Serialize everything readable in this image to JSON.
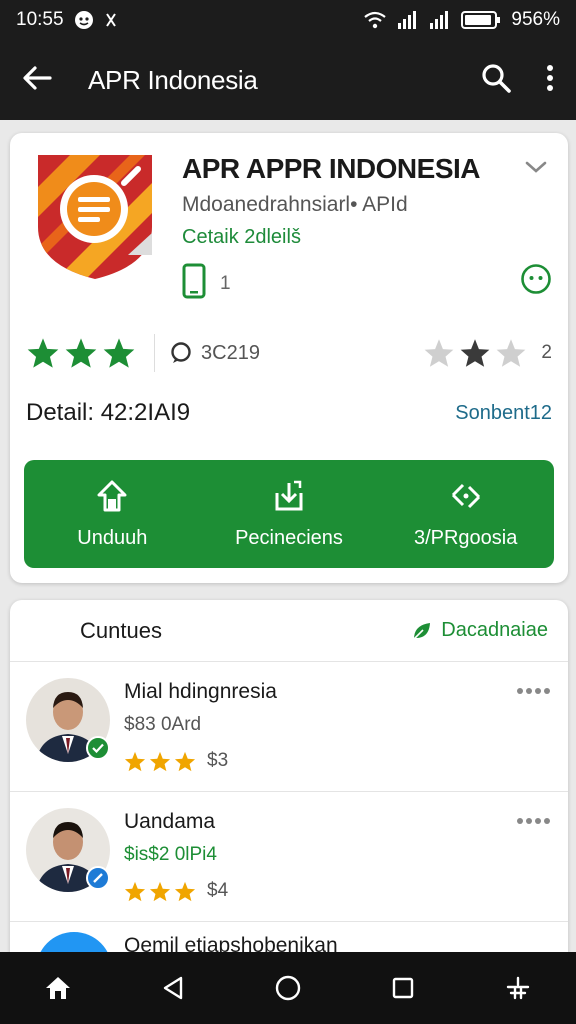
{
  "status_bar": {
    "time": "10:55",
    "battery": "956%"
  },
  "app_bar": {
    "title": "APR Indonesia"
  },
  "app": {
    "title": "APR APPR INDONESIA",
    "subtitle": "Mdoanedrahnsiarl• APId",
    "category": "Cetaik 2dleilš",
    "device_count": "1",
    "rating_stars": 3,
    "review_count": "3C219",
    "secondary_rating": "2",
    "detail_label": "Detail: 42:2IAI9",
    "detail_link": "Sonbent12"
  },
  "actions": [
    {
      "label": "Unduuh",
      "icon": "home-up-icon"
    },
    {
      "label": "Pecineciens",
      "icon": "share-icon"
    },
    {
      "label": "3/PRgoosia",
      "icon": "sync-icon"
    }
  ],
  "list": {
    "title": "Cuntues",
    "action_label": "Dacadnaiae",
    "items": [
      {
        "name": "Mial hdingnresia",
        "price": "$83 0Ard",
        "rating_value": "$3",
        "stars": 3,
        "badge_color": "#1d8e35"
      },
      {
        "name": "Uandama",
        "price": "$is$2 0lPi4",
        "rating_value": "$4",
        "stars": 3,
        "badge_color": "#1e7bd6"
      }
    ],
    "partial_item": {
      "name": "Qemil etiapshobenikan"
    }
  },
  "colors": {
    "primary_green": "#1d8e35",
    "star_gold": "#f0a500",
    "dark_bar": "#1c1c1c"
  }
}
